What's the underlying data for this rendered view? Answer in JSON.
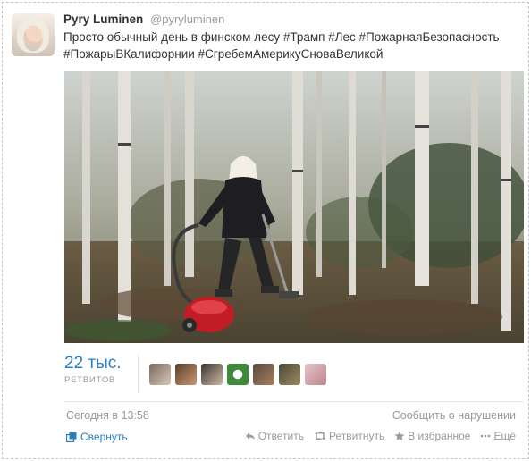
{
  "tweet": {
    "display_name": "Pyry Luminen",
    "handle": "@pyryluminen",
    "text_line1": "Просто обычный день в финском лесу #Трамп #Лес #ПожарнаяБезопасность",
    "text_line2": "#ПожарыВКалифорнии #СгребемАмерикуСноваВеликой"
  },
  "stats": {
    "retweets_count": "22 тыс.",
    "retweets_label": "РЕТВИТОВ",
    "retweeter_avatars": [
      "retweeter-1",
      "retweeter-2",
      "retweeter-3",
      "retweeter-4",
      "retweeter-5",
      "retweeter-6",
      "retweeter-7"
    ]
  },
  "meta": {
    "timestamp": "Сегодня в 13:58",
    "report_label": "Сообщить о нарушении"
  },
  "actions": {
    "collapse_label": "Свернуть",
    "reply_label": "Ответить",
    "retweet_label": "Ретвитнуть",
    "favorite_label": "В избранное",
    "more_label": "Ещё"
  },
  "colors": {
    "link": "#2a7fbd",
    "muted": "#999999",
    "text": "#333333"
  }
}
